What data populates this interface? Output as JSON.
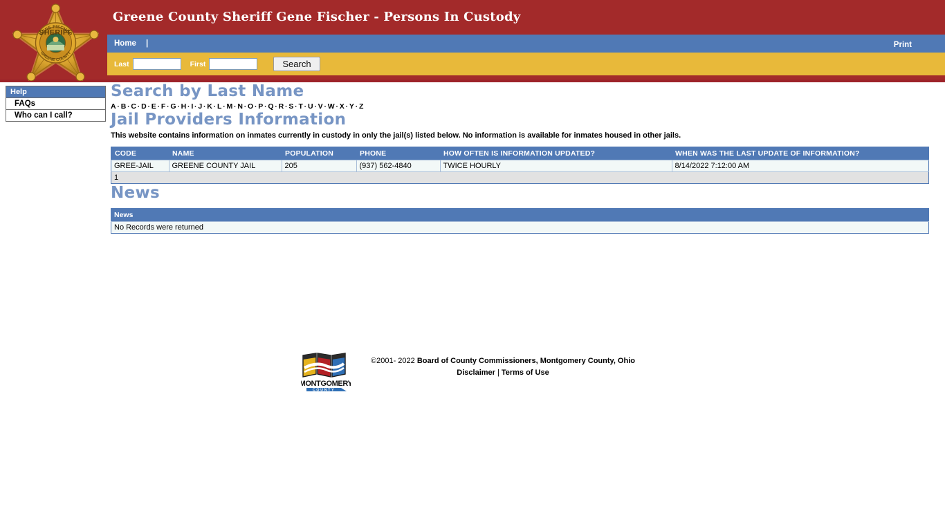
{
  "header": {
    "title": "Greene County Sheriff Gene Fischer - Persons In Custody",
    "badge_icon": "sheriff-star-badge-icon",
    "badge_text_top": "GENE FISCHER",
    "badge_text_mid": "SHERIFF",
    "badge_text_bottom": "GREENE COUNTY",
    "colors": {
      "header_red": "#A32A2A",
      "nav_blue": "#5079B5",
      "search_gold": "#E8B93A",
      "heading_blue": "#7795C4",
      "row_bg": "#F2F8F7",
      "footer_row_bg": "#E2E2E2"
    }
  },
  "nav": {
    "home_label": "Home",
    "separator": "|",
    "print_label": "Print"
  },
  "search": {
    "last_label": "Last",
    "last_value": "",
    "last_placeholder": "",
    "first_label": "First",
    "first_value": "",
    "first_placeholder": "",
    "button_label": "Search"
  },
  "sidebar": {
    "heading": "Help",
    "items": [
      {
        "label": "FAQs"
      },
      {
        "label": "Who can I call?"
      }
    ]
  },
  "main": {
    "search_by_last_name_title": "Search by Last Name",
    "alphabet": [
      "A",
      "B",
      "C",
      "D",
      "E",
      "F",
      "G",
      "H",
      "I",
      "J",
      "K",
      "L",
      "M",
      "N",
      "O",
      "P",
      "Q",
      "R",
      "S",
      "T",
      "U",
      "V",
      "W",
      "X",
      "Y",
      "Z"
    ],
    "alphabet_separator": "·",
    "jail_providers_title": "Jail Providers Information",
    "jail_providers_description": "This website contains information on inmates currently in custody in only the jail(s) listed below. No information is available for inmates housed in other jails.",
    "jail_table": {
      "columns": [
        "CODE",
        "NAME",
        "POPULATION",
        "PHONE",
        "HOW OFTEN IS INFORMATION UPDATED?",
        "WHEN WAS THE LAST UPDATE OF INFORMATION?"
      ],
      "rows": [
        {
          "code": "GREE-JAIL",
          "name": "GREENE COUNTY JAIL",
          "population": "205",
          "phone": "(937) 562-4840",
          "how_often": "TWICE HOURLY",
          "last_update": "8/14/2022 7:12:00 AM"
        }
      ],
      "pager": "1"
    },
    "news_title": "News",
    "news_table": {
      "column": "News",
      "empty_message": "No Records were returned"
    }
  },
  "footer": {
    "logo_icon": "montgomery-county-logo-icon",
    "logo_text_main": "MONTGOMERY",
    "logo_text_sub": "C O U N T Y",
    "copyright_symbol": "©2001- 2022 ",
    "copyright_owner": "Board of County Commissioners, Montgomery County, Ohio",
    "disclaimer_label": "Disclaimer",
    "links_separator": "|",
    "terms_label": "Terms of Use"
  }
}
